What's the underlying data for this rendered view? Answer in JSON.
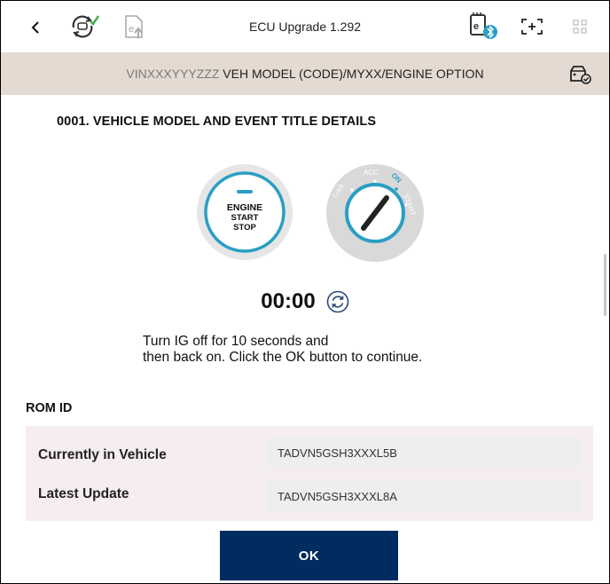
{
  "header": {
    "title": "ECU Upgrade 1.292",
    "icons": [
      "back-icon",
      "diagnostic-cycle-icon",
      "ecu-upload-icon",
      "ecu-bluetooth-icon",
      "expand-icon",
      "grid-icon"
    ]
  },
  "vehicle_bar": {
    "vin": "VINXXXYYYZZZ",
    "model": " VEH MODEL (CODE)/MYXX/ENGINE OPTION",
    "icon": "vehicle-check-icon"
  },
  "event": {
    "title": "0001. VEHICLE MODEL AND EVENT TITLE DETAILS"
  },
  "engine_button": {
    "line1": "ENGINE",
    "line2": "START",
    "line3": "STOP"
  },
  "ignition": {
    "lock": "Lock",
    "acc": "ACC",
    "on": "ON",
    "start": "START"
  },
  "timer": {
    "value": "00:00"
  },
  "instruction": {
    "line1": "Turn IG off for 10 seconds and",
    "line2": "then back on. Click the OK button to continue."
  },
  "rom": {
    "label": "ROM ID",
    "rows": [
      {
        "label": "Currently in Vehicle",
        "value": "TADVN5GSH3XXXL5B"
      },
      {
        "label": "Latest Update",
        "value": "TADVN5GSH3XXXL8A"
      }
    ]
  },
  "ok_button": {
    "label": "OK"
  },
  "colors": {
    "vehicle_bar_bg": "#e4dad1",
    "ok_button_bg": "#002c5f",
    "accent_teal": "#2a9fc4"
  }
}
